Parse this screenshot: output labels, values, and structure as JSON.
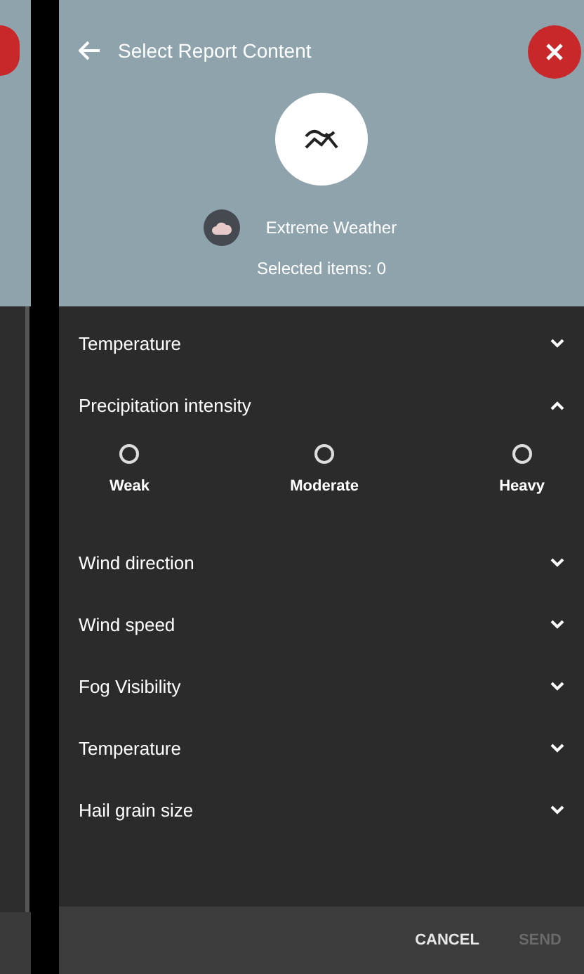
{
  "background_screen": {
    "close_visible": true
  },
  "header": {
    "title": "Select Report Content",
    "category": "Extreme Weather",
    "selected_items": "Selected items: 0"
  },
  "sections": [
    {
      "label": "Temperature",
      "expanded": false
    },
    {
      "label": "Precipitation intensity",
      "expanded": true,
      "options": [
        {
          "label": "Weak",
          "selected": false
        },
        {
          "label": "Moderate",
          "selected": false
        },
        {
          "label": "Heavy",
          "selected": false
        }
      ]
    },
    {
      "label": "Wind direction",
      "expanded": false
    },
    {
      "label": "Wind speed",
      "expanded": false
    },
    {
      "label": "Fog Visibility",
      "expanded": false
    },
    {
      "label": "Temperature",
      "expanded": false
    },
    {
      "label": "Hail grain size",
      "expanded": false
    }
  ],
  "footer": {
    "buttons": [
      {
        "label": "CANCEL",
        "disabled": false
      },
      {
        "label": "SEND",
        "disabled": true
      }
    ]
  }
}
